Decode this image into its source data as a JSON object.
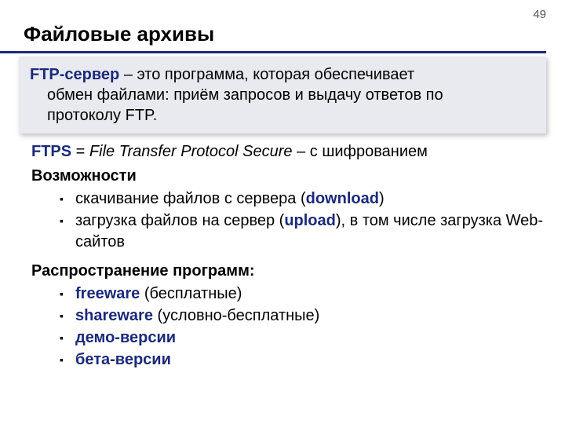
{
  "pageNumber": "49",
  "title": "Файловые архивы",
  "definition": {
    "term": "FTP-сервер",
    "line1_rest": " – это программа, которая обеспечивает",
    "line2": "обмен файлами: приём запросов и выдачу ответов по",
    "line3": "протоколу FTP."
  },
  "ftps": {
    "abbr": "FTPS",
    "eq": " = ",
    "expansion": "File Transfer Protocol Secure",
    "tail": " – с шифрованием"
  },
  "capabilities": {
    "heading": "Возможности",
    "item1_pre": "скачивание файлов c сервера (",
    "item1_term": "download",
    "item1_post": ")",
    "item2_pre": "загрузка файлов на сервер (",
    "item2_term": "upload",
    "item2_post": "), в том числе загрузка Web-сайтов"
  },
  "distribution": {
    "heading": "Распространение программ:",
    "item1_term": "freeware",
    "item1_rest": " (бесплатные)",
    "item2_term": "shareware",
    "item2_rest": " (условно-бесплатные)",
    "item3_term": "демо-версии",
    "item4_term": "бета-версии"
  }
}
